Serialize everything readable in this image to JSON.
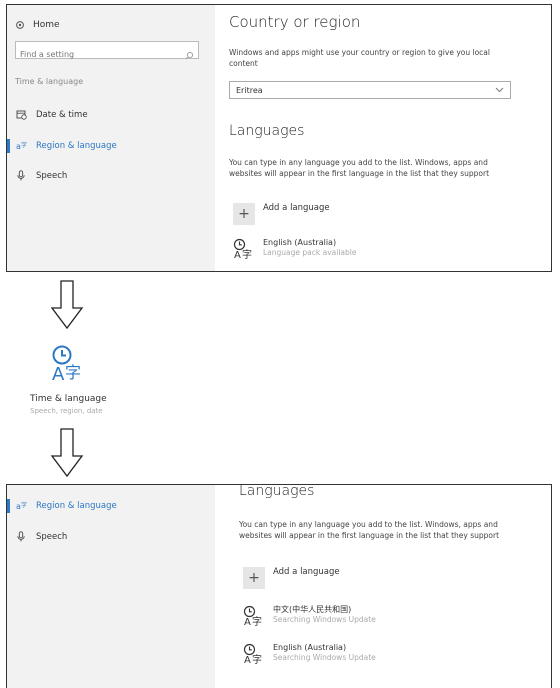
{
  "panel1": {
    "sidebar": {
      "home_label": "Home",
      "search_placeholder": "Find a setting",
      "section_label": "Time & language",
      "items": [
        {
          "label": "Date & time",
          "icon": "calendar-clock-icon"
        },
        {
          "label": "Region & language",
          "icon": "region-language-icon",
          "active": true
        },
        {
          "label": "Speech",
          "icon": "microphone-icon"
        }
      ]
    },
    "content": {
      "country_heading": "Country or region",
      "country_desc": "Windows and apps might use your country or region to give you local content",
      "country_value": "Eritrea",
      "languages_heading": "Languages",
      "languages_desc": "You can type in any language you add to the list. Windows, apps and websites will appear in the first language in the list that they support",
      "add_language_label": "Add a language",
      "languages": [
        {
          "name": "English (Australia)",
          "status": "Language pack available"
        }
      ]
    }
  },
  "tile": {
    "title": "Time & language",
    "subtitle": "Speech, region, date"
  },
  "panel2": {
    "sidebar": {
      "items": [
        {
          "label": "Region & language",
          "icon": "region-language-icon",
          "active": true
        },
        {
          "label": "Speech",
          "icon": "microphone-icon"
        }
      ]
    },
    "content": {
      "languages_heading": "Languages",
      "languages_desc": "You can type in any language you add to the list. Windows, apps and websites will appear in the first language in the list that they support",
      "add_language_label": "Add a language",
      "languages": [
        {
          "name": "中文(中华人民共和国)",
          "status": "Searching Windows Update"
        },
        {
          "name": "English (Australia)",
          "status": "Searching Windows Update"
        }
      ]
    }
  },
  "colors": {
    "accent": "#2b78c5",
    "sidebar_bg": "#f2f2f2",
    "muted_text": "#aaaaaa"
  }
}
